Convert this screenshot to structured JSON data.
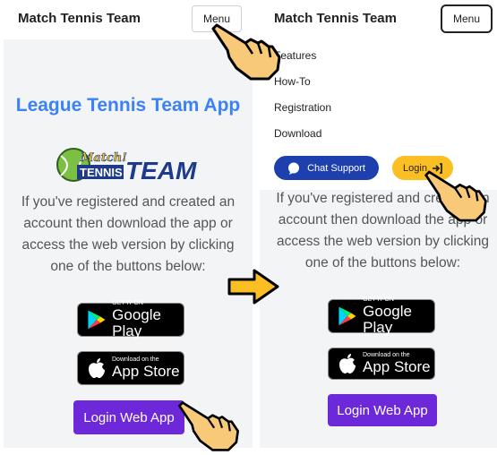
{
  "left": {
    "header": {
      "brand": "Match Tennis Team",
      "menu_label": "Menu"
    },
    "title": "League Tennis Team App",
    "logo": {
      "match": "Match!",
      "tennis": "TENNIS",
      "team": "TEAM"
    },
    "description": "If you've registered and created an account then download the app or access the web version by clicking one of the buttons below:",
    "google_play": {
      "small": "GET IT ON",
      "big": "Google Play"
    },
    "app_store": {
      "small": "Download on the",
      "big": "App Store"
    },
    "web_button": "Login Web App"
  },
  "right": {
    "header": {
      "brand": "Match Tennis Team",
      "menu_label": "Menu"
    },
    "menu_items": [
      "Features",
      "How-To",
      "Registration",
      "Download"
    ],
    "chat_support": "Chat Support",
    "login": "Login",
    "description": "If you've registered and created an account then download the app or access the web version by clicking one of the buttons below:",
    "google_play": {
      "small": "GET IT ON",
      "big": "Google Play"
    },
    "app_store": {
      "small": "Download on the",
      "big": "App Store"
    },
    "web_button": "Login Web App"
  },
  "colors": {
    "accent": "#3b82f6",
    "web_button": "#6d28d9",
    "chat": "#1e40af",
    "login": "#fbbf24",
    "arrow": "#fbbf24"
  },
  "icons": [
    "pointing-hand-icon",
    "arrow-right-icon",
    "login-icon",
    "chat-icon",
    "google-play-icon",
    "apple-icon"
  ]
}
